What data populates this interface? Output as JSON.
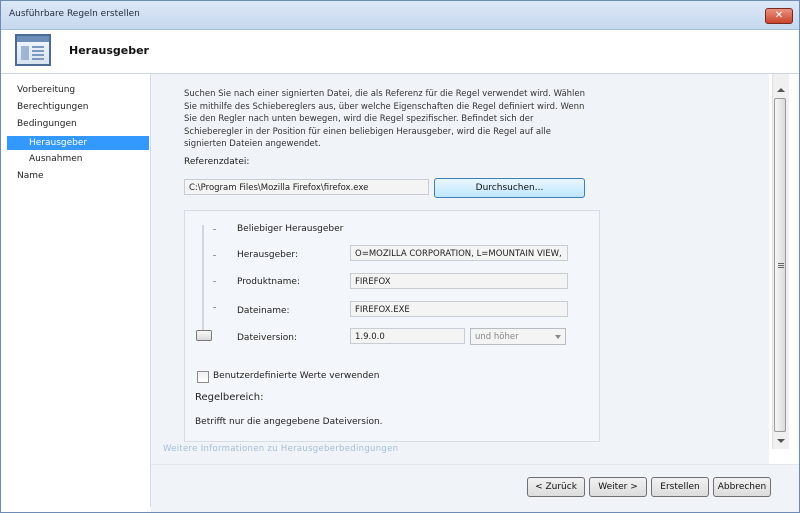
{
  "window": {
    "title": "Ausführbare Regeln erstellen",
    "close_icon": "close-icon"
  },
  "header": {
    "title": "Herausgeber",
    "icon": "rule-wizard-icon"
  },
  "nav": {
    "items": [
      {
        "label": "Vorbereitung"
      },
      {
        "label": "Berechtigungen"
      },
      {
        "label": "Bedingungen"
      },
      {
        "label": "Herausgeber",
        "selected": true
      },
      {
        "label": "Ausnahmen"
      },
      {
        "label": "Name"
      }
    ]
  },
  "main": {
    "description": "Suchen Sie nach einer signierten Datei, die als Referenz für die Regel verwendet wird. Wählen Sie mithilfe des Schiebereglers aus, über welche Eigenschaften die Regel definiert wird. Wenn Sie den Regler nach unten bewegen, wird die Regel spezifischer. Befindet sich der Schieberegler in der Position für einen beliebigen Herausgeber, wird die Regel auf alle signierten Dateien angewendet.",
    "reference_label": "Referenzdatei:",
    "reference_value": "C:\\Program Files\\Mozilla Firefox\\firefox.exe",
    "browse_label": "Durchsuchen...",
    "any_publisher_label": "Beliebiger Herausgeber",
    "publisher_label": "Herausgeber:",
    "publisher_value": "O=MOZILLA CORPORATION, L=MOUNTAIN VIEW,",
    "product_label": "Produktname:",
    "product_value": "FIREFOX",
    "filename_label": "Dateiname:",
    "filename_value": "FIREFOX.EXE",
    "version_label": "Dateiversion:",
    "version_value": "1.9.0.0",
    "version_option": "und höher",
    "custom_values_label": "Benutzerdefinierte Werte verwenden",
    "custom_values_checked": false,
    "scope_heading": "Regelbereich:",
    "scope_text": "Betrifft nur die angegebene Dateiversion.",
    "more_info_link": "Weitere Informationen zu Herausgeberbedingungen",
    "slider_level": "Dateiversion"
  },
  "footer": {
    "back_label": "< Zurück",
    "next_label": "Weiter >",
    "create_label": "Erstellen",
    "cancel_label": "Abbrechen"
  },
  "colors": {
    "selection": "#3399ff",
    "content_bg": "#f0f4f9",
    "titlebar": "#c6d8ee",
    "close": "#c7452c"
  }
}
